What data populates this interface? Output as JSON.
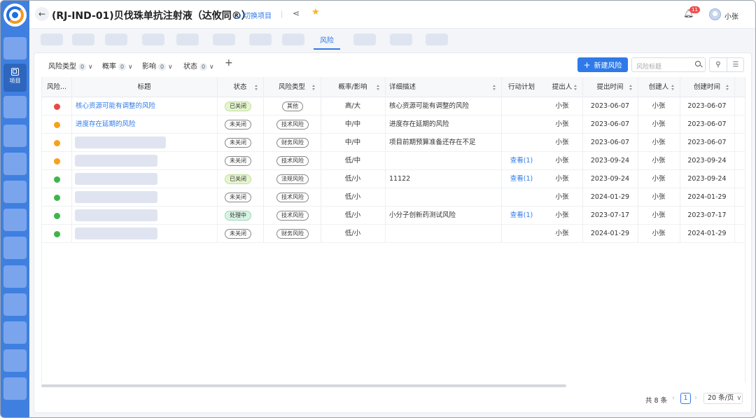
{
  "header": {
    "title": "(RJ-IND-01)贝伐珠单抗注射液（达攸同®）",
    "switch_label": "切换项目",
    "notification_count": "11",
    "user_name": "小张"
  },
  "sidebar": {
    "active_label": "项目"
  },
  "tabs": {
    "active_label": "风险"
  },
  "toolbar": {
    "filters": [
      {
        "label": "风险类型",
        "count": "0"
      },
      {
        "label": "概率",
        "count": "0"
      },
      {
        "label": "影响",
        "count": "0"
      },
      {
        "label": "状态",
        "count": "0"
      }
    ],
    "add_label": "+",
    "new_button": "新建风险",
    "search_placeholder": "风险标题"
  },
  "table": {
    "columns": [
      "风险...",
      "标题",
      "状态",
      "风险类型",
      "概率/影响",
      "详细描述",
      "行动计划",
      "提出人",
      "提出时间",
      "创建人",
      "创建时间"
    ],
    "rows": [
      {
        "dot": "#e84848",
        "title": "核心资源可能有调整的风险",
        "status": "已关闭",
        "status_style": "done",
        "type": "其他",
        "prob": "高/大",
        "desc": "核心资源可能有调整的风险",
        "plan": "",
        "proposer": "小张",
        "proposed": "2023-06-07",
        "creator": "小张",
        "created": "2023-06-07"
      },
      {
        "dot": "#f5a21b",
        "title": "进度存在延期的风险",
        "status": "未关闭",
        "status_style": "open",
        "type": "技术风险",
        "prob": "中/中",
        "desc": "进度存在延期的风险",
        "plan": "",
        "proposer": "小张",
        "proposed": "2023-06-07",
        "creator": "小张",
        "created": "2023-06-07"
      },
      {
        "dot": "#f5a21b",
        "title": "",
        "status": "未关闭",
        "status_style": "open",
        "type": "财务风险",
        "prob": "中/中",
        "desc": "项目前期预算准备还存在不足",
        "plan": "",
        "proposer": "小张",
        "proposed": "2023-06-07",
        "creator": "小张",
        "created": "2023-06-07"
      },
      {
        "dot": "#f5a21b",
        "title": "",
        "status": "未关闭",
        "status_style": "open",
        "type": "技术风险",
        "prob": "低/中",
        "desc": "",
        "plan": "查看(1)",
        "proposer": "小张",
        "proposed": "2023-09-24",
        "creator": "小张",
        "created": "2023-09-24"
      },
      {
        "dot": "#3db54a",
        "title": "",
        "status": "已关闭",
        "status_style": "done",
        "type": "法规风险",
        "prob": "低/小",
        "desc": "11122",
        "plan": "查看(1)",
        "proposer": "小张",
        "proposed": "2023-09-24",
        "creator": "小张",
        "created": "2023-09-24"
      },
      {
        "dot": "#3db54a",
        "title": "",
        "status": "未关闭",
        "status_style": "open",
        "type": "技术风险",
        "prob": "低/小",
        "desc": "",
        "plan": "",
        "proposer": "小张",
        "proposed": "2024-01-29",
        "creator": "小张",
        "created": "2024-01-29"
      },
      {
        "dot": "#3db54a",
        "title": "",
        "status": "处理中",
        "status_style": "active",
        "type": "技术风险",
        "prob": "低/小",
        "desc": "小分子创新药测试风险",
        "plan": "查看(1)",
        "proposer": "小张",
        "proposed": "2023-07-17",
        "creator": "小张",
        "created": "2023-07-17"
      },
      {
        "dot": "#3db54a",
        "title": "",
        "status": "未关闭",
        "status_style": "open",
        "type": "财务风险",
        "prob": "低/小",
        "desc": "",
        "plan": "",
        "proposer": "小张",
        "proposed": "2024-01-29",
        "creator": "小张",
        "created": "2024-01-29"
      }
    ]
  },
  "pagination": {
    "total": "共 8 条",
    "current_page": "1",
    "page_size": "20 条/页"
  }
}
